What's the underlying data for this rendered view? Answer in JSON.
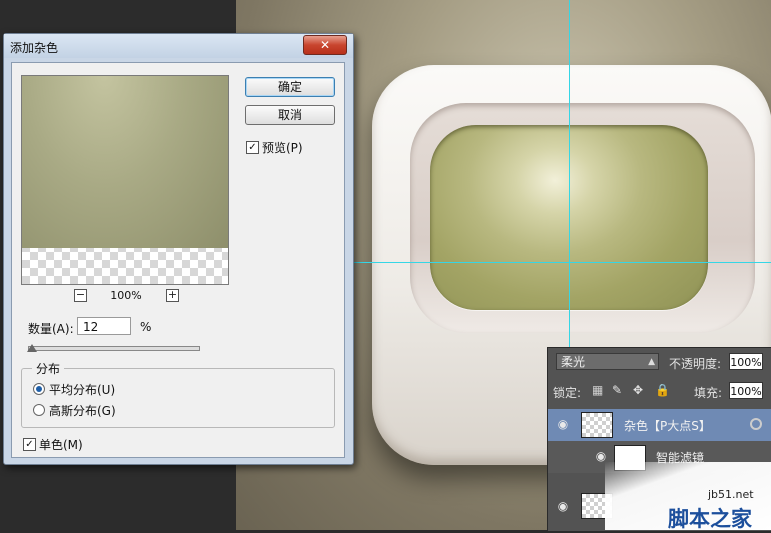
{
  "dialog": {
    "title": "添加杂色",
    "close_label": "✕",
    "ok_label": "确定",
    "cancel_label": "取消",
    "preview_label": "预览(P)",
    "preview_checked": true,
    "zoom_minus": "−",
    "zoom_plus": "+",
    "zoom_value": "100%",
    "amount_label": "数量(A):",
    "amount_value": "12",
    "amount_unit": "%",
    "amount_slider_fraction": 0.12,
    "distribution_title": "分布",
    "distribution_options": [
      {
        "label": "平均分布(U)",
        "selected": true
      },
      {
        "label": "高斯分布(G)",
        "selected": false
      }
    ],
    "monochrome_label": "单色(M)",
    "monochrome_checked": true
  },
  "layers_panel": {
    "blend_mode": "柔光",
    "opacity_label": "不透明度:",
    "opacity_value": "100%",
    "lock_label": "锁定:",
    "lock_icons": [
      "lock-pixels-icon",
      "brush-icon",
      "move-icon",
      "lock-icon"
    ],
    "fill_label": "填充:",
    "fill_value": "100%",
    "layers": [
      {
        "name": "杂色【P大点S】",
        "selected": true
      },
      {
        "name": "智能滤镜",
        "selected": false
      }
    ]
  },
  "watermark": {
    "site": "jb51.net",
    "text": "脚本之家"
  },
  "colors": {
    "accent_selected_layer": "#6f8ab4",
    "guide": "#35d6e6",
    "close_button": "#c8452e"
  }
}
